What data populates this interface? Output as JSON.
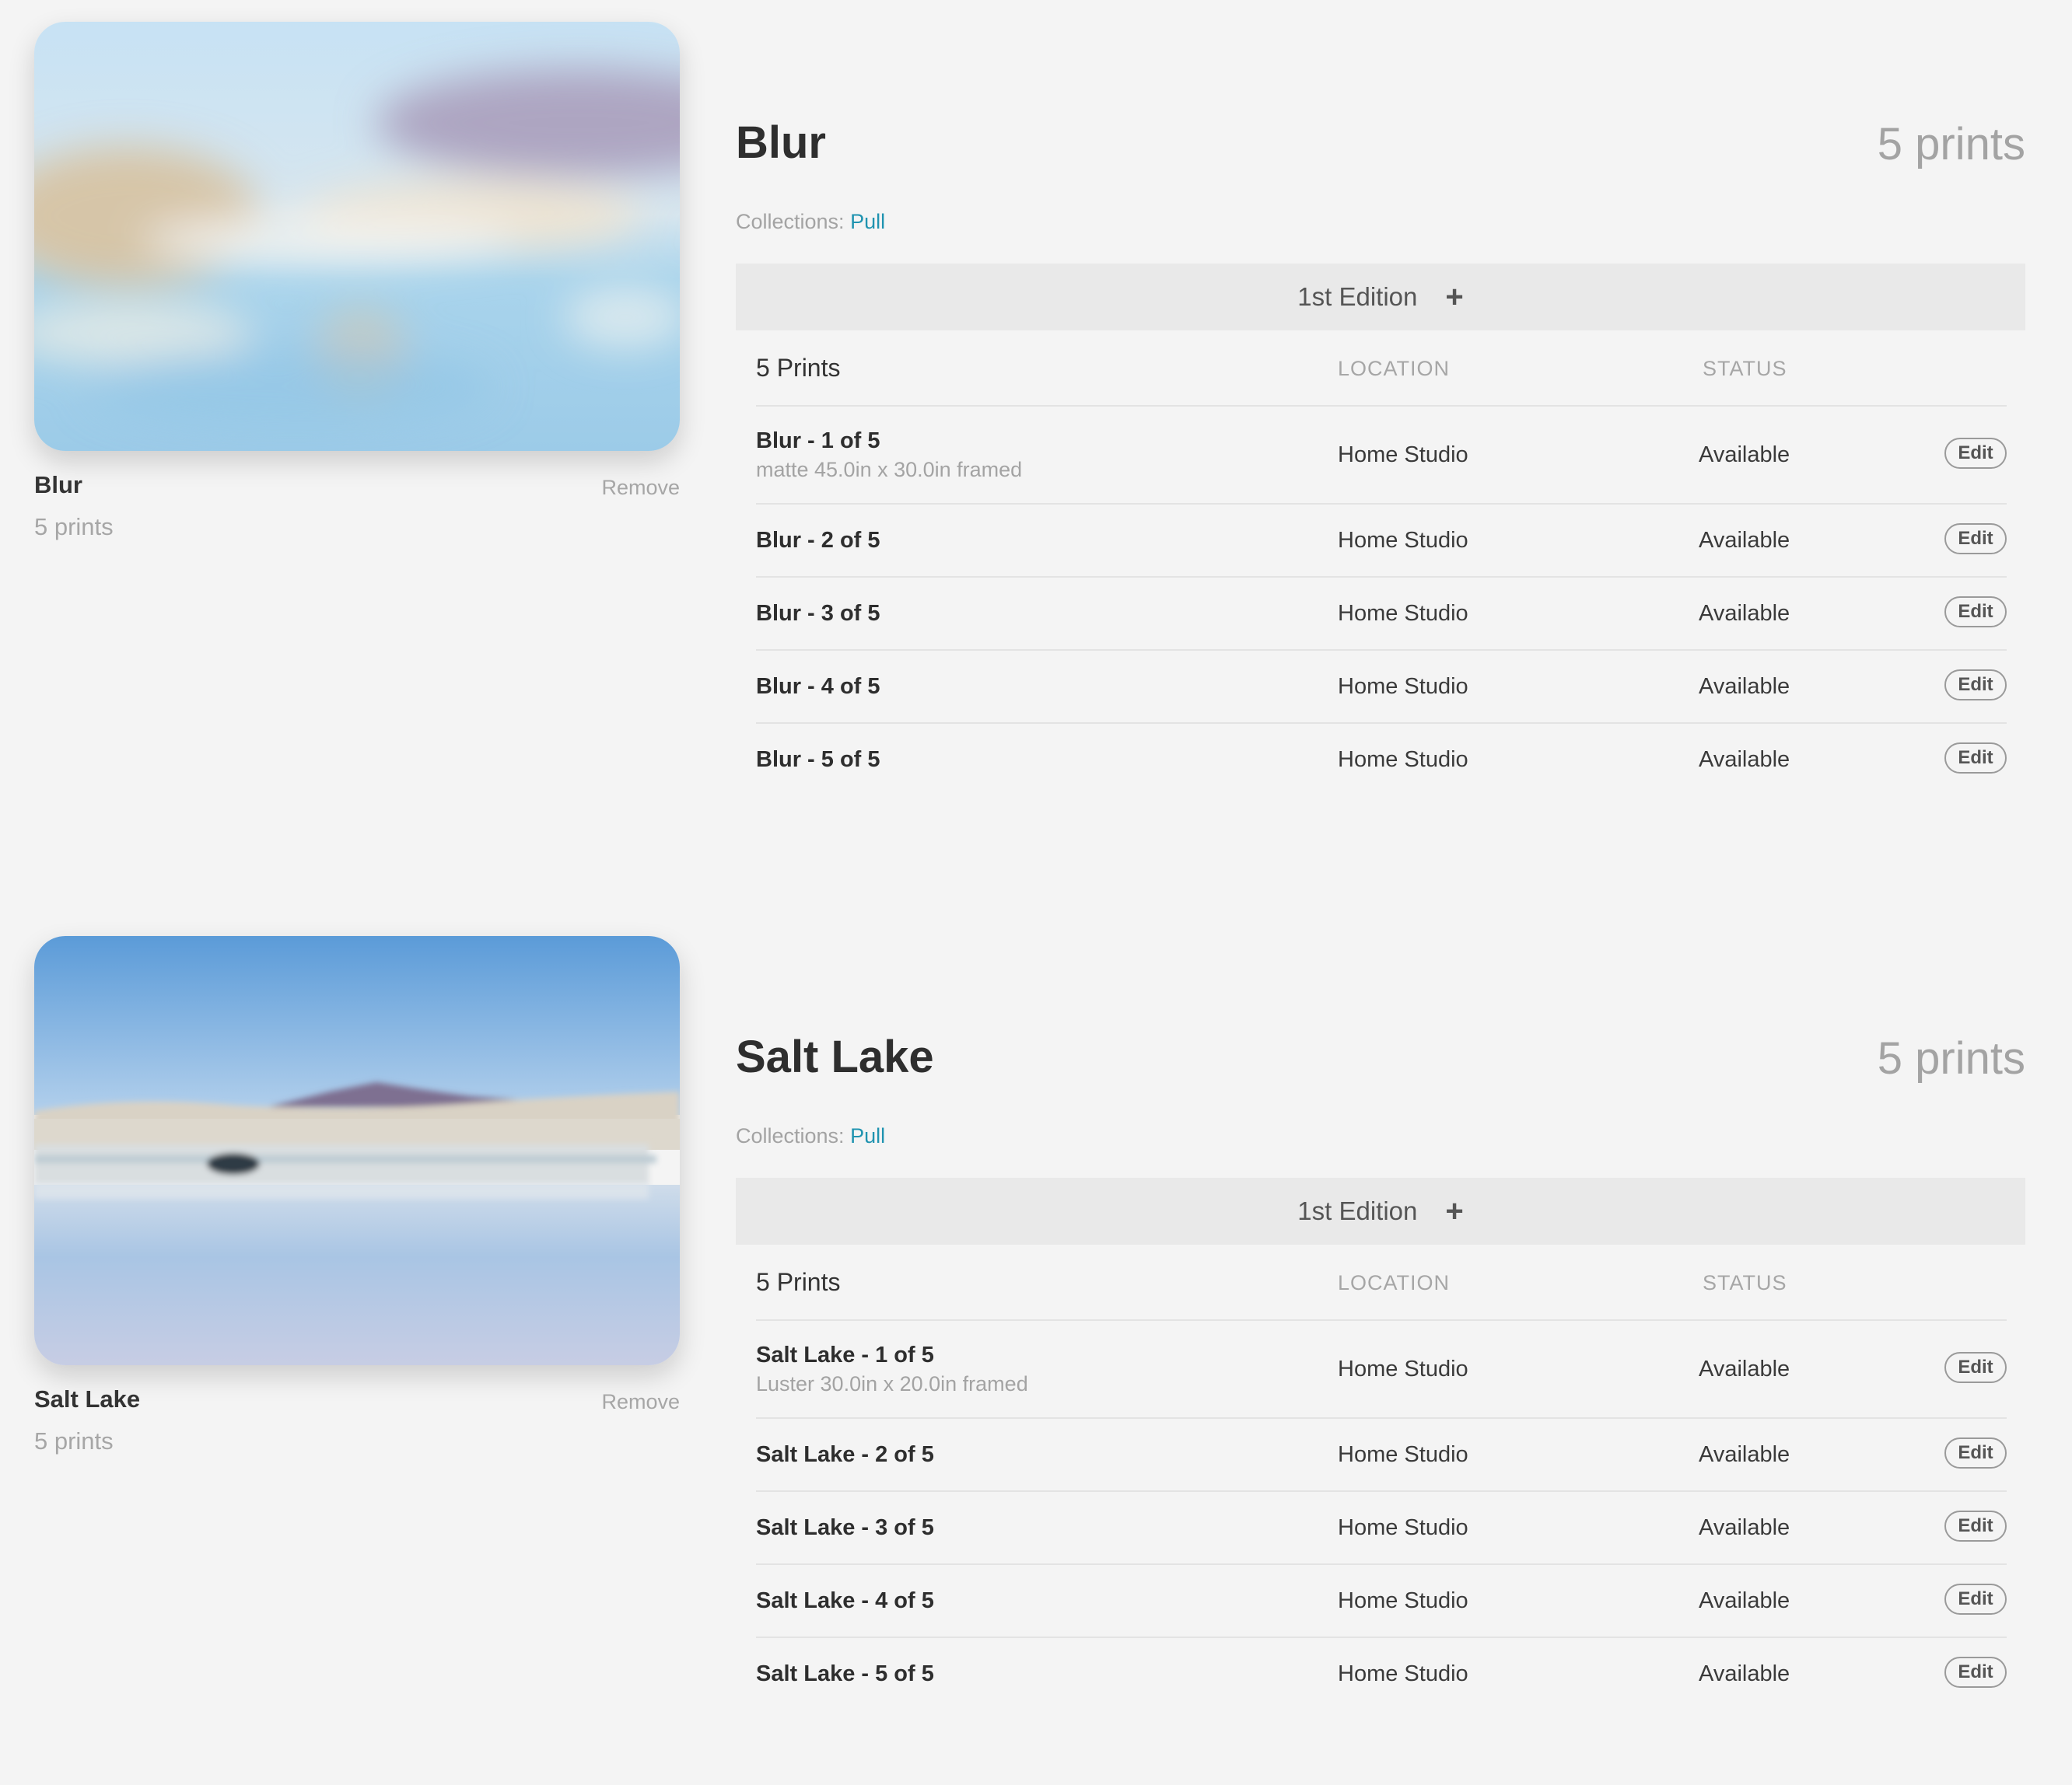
{
  "artworks": [
    {
      "title": "Blur",
      "count_text": "5 prints",
      "remove_label": "Remove",
      "image": "blurred-lake-landscape",
      "collections_label": "Collections:",
      "collection": "Pull",
      "edition_label": "1st Edition",
      "add_icon": "plus-icon",
      "table": {
        "prints_header": "5 Prints",
        "location_header": "LOCATION",
        "status_header": "STATUS",
        "rows": [
          {
            "name": "Blur - 1 of 5",
            "desc": "matte 45.0in x 30.0in framed",
            "location": "Home Studio",
            "status": "Available",
            "action": "Edit"
          },
          {
            "name": "Blur - 2 of 5",
            "desc": "",
            "location": "Home Studio",
            "status": "Available",
            "action": "Edit"
          },
          {
            "name": "Blur - 3 of 5",
            "desc": "",
            "location": "Home Studio",
            "status": "Available",
            "action": "Edit"
          },
          {
            "name": "Blur - 4 of 5",
            "desc": "",
            "location": "Home Studio",
            "status": "Available",
            "action": "Edit"
          },
          {
            "name": "Blur - 5 of 5",
            "desc": "",
            "location": "Home Studio",
            "status": "Available",
            "action": "Edit"
          }
        ]
      }
    },
    {
      "title": "Salt Lake",
      "count_text": "5 prints",
      "remove_label": "Remove",
      "image": "salt-lake-landscape",
      "collections_label": "Collections:",
      "collection": "Pull",
      "edition_label": "1st Edition",
      "add_icon": "plus-icon",
      "table": {
        "prints_header": "5 Prints",
        "location_header": "LOCATION",
        "status_header": "STATUS",
        "rows": [
          {
            "name": "Salt Lake - 1 of 5",
            "desc": "Luster 30.0in x 20.0in framed",
            "location": "Home Studio",
            "status": "Available",
            "action": "Edit"
          },
          {
            "name": "Salt Lake - 2 of 5",
            "desc": "",
            "location": "Home Studio",
            "status": "Available",
            "action": "Edit"
          },
          {
            "name": "Salt Lake - 3 of 5",
            "desc": "",
            "location": "Home Studio",
            "status": "Available",
            "action": "Edit"
          },
          {
            "name": "Salt Lake - 4 of 5",
            "desc": "",
            "location": "Home Studio",
            "status": "Available",
            "action": "Edit"
          },
          {
            "name": "Salt Lake - 5 of 5",
            "desc": "",
            "location": "Home Studio",
            "status": "Available",
            "action": "Edit"
          }
        ]
      }
    }
  ],
  "colors": {
    "background": "#f4f4f4",
    "link": "#1f93b0",
    "muted_text": "#a6a6a6",
    "edition_bar": "#e9e9e9"
  }
}
